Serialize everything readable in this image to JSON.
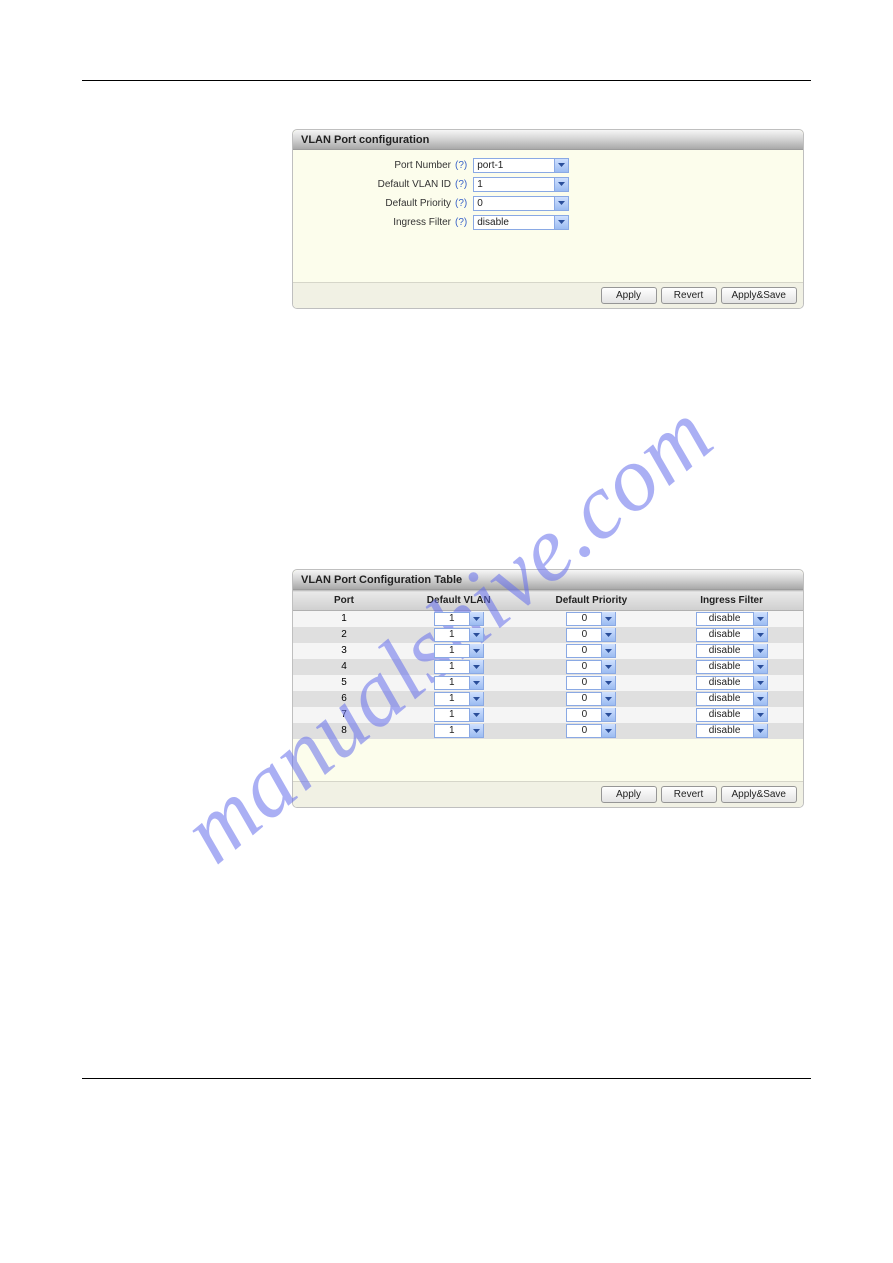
{
  "watermark": "manualshive.com",
  "panel1": {
    "title": "VLAN Port configuration",
    "rows": {
      "portNumber": {
        "label": "Port Number",
        "help": "(?)",
        "value": "port-1"
      },
      "defaultVlanId": {
        "label": "Default VLAN ID",
        "help": "(?)",
        "value": "1"
      },
      "defaultPriority": {
        "label": "Default Priority",
        "help": "(?)",
        "value": "0"
      },
      "ingressFilter": {
        "label": "Ingress Filter",
        "help": "(?)",
        "value": "disable"
      }
    },
    "buttons": {
      "apply": "Apply",
      "revert": "Revert",
      "applySave": "Apply&Save"
    }
  },
  "panel2": {
    "title": "VLAN Port Configuration Table",
    "headers": {
      "port": "Port",
      "defaultVlan": "Default VLAN",
      "defaultPriority": "Default Priority",
      "ingressFilter": "Ingress Filter"
    },
    "rows": [
      {
        "port": "1",
        "vlan": "1",
        "priority": "0",
        "filter": "disable"
      },
      {
        "port": "2",
        "vlan": "1",
        "priority": "0",
        "filter": "disable"
      },
      {
        "port": "3",
        "vlan": "1",
        "priority": "0",
        "filter": "disable"
      },
      {
        "port": "4",
        "vlan": "1",
        "priority": "0",
        "filter": "disable"
      },
      {
        "port": "5",
        "vlan": "1",
        "priority": "0",
        "filter": "disable"
      },
      {
        "port": "6",
        "vlan": "1",
        "priority": "0",
        "filter": "disable"
      },
      {
        "port": "7",
        "vlan": "1",
        "priority": "0",
        "filter": "disable"
      },
      {
        "port": "8",
        "vlan": "1",
        "priority": "0",
        "filter": "disable"
      }
    ],
    "buttons": {
      "apply": "Apply",
      "revert": "Revert",
      "applySave": "Apply&Save"
    }
  }
}
